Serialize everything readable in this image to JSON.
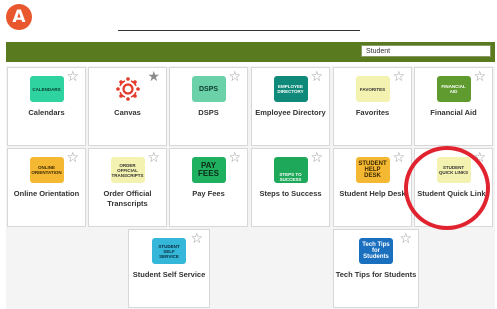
{
  "step_badge": "A",
  "search": {
    "value": "Student"
  },
  "tiles": [
    {
      "label": "Calendars",
      "logo": "CALENDARS",
      "bg": "#2ed3a0",
      "fg": "#0b3b2c"
    },
    {
      "label": "Canvas",
      "logo": "",
      "bg": "#ffffff",
      "fg": "#e13b2c"
    },
    {
      "label": "DSPS",
      "logo": "DSPS",
      "bg": "#6ad1a8",
      "fg": "#0b3b2c"
    },
    {
      "label": "Employee Directory",
      "logo": "EMPLOYEE DIRECTORY",
      "bg": "#0f8a7a",
      "fg": "#ffffff"
    },
    {
      "label": "Favorites",
      "logo": "FAVORITES",
      "bg": "#f4f2b0",
      "fg": "#333333"
    },
    {
      "label": "Financial Aid",
      "logo": "FINANCIAL AID",
      "bg": "#5f9b2e",
      "fg": "#ffffff"
    },
    {
      "label": "Online Orientation",
      "logo": "ONLINE ORIENTATION",
      "bg": "#f5b833",
      "fg": "#3a2a00"
    },
    {
      "label": "Order Official Transcripts",
      "logo": "ORDER OFFICIAL TRANSCRIPTS",
      "bg": "#f4f2b0",
      "fg": "#333333"
    },
    {
      "label": "Pay Fees",
      "logo": "PAY FEES",
      "bg": "#1fb060",
      "fg": "#0b2b16"
    },
    {
      "label": "Steps to Success",
      "logo": "STEPS TO SUCCESS",
      "bg": "#1ea85a",
      "fg": "#ffffff"
    },
    {
      "label": "Student Help Desk",
      "logo": "STUDENT HELP DESK",
      "bg": "#f5b833",
      "fg": "#3a2a00"
    },
    {
      "label": "Student Quick Links",
      "logo": "STUDENT QUICK LINKS",
      "bg": "#f4f2b0",
      "fg": "#333333"
    },
    {
      "label": "Student Self Service",
      "logo": "STUDENT SELF SERVICE",
      "bg": "#34b7d8",
      "fg": "#0b2b3b"
    },
    {
      "label": "Tech Tips for Students",
      "logo": "Tech Tips for Students",
      "bg": "#1a6fbf",
      "fg": "#ffffff"
    }
  ]
}
